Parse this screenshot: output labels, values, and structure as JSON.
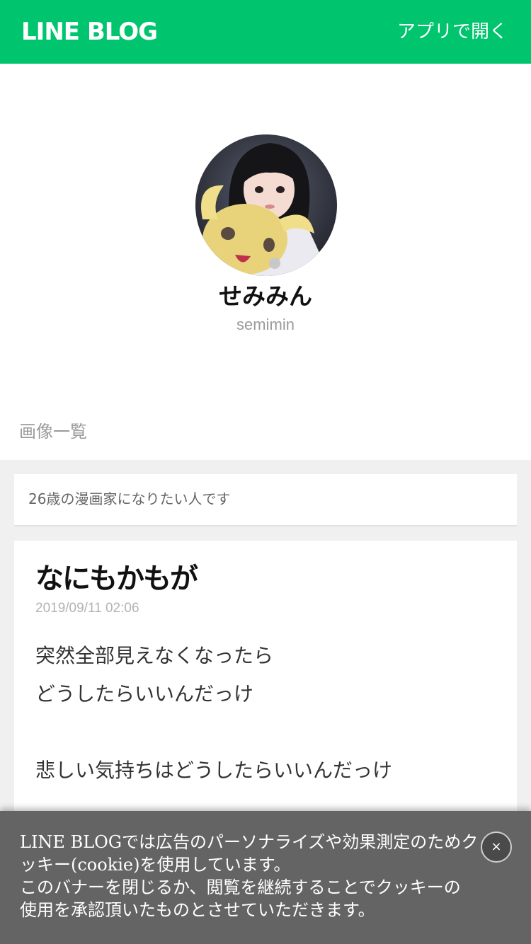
{
  "header": {
    "logo": "LINE BLOG",
    "open_app": "アプリで開く"
  },
  "profile": {
    "name": "せみみん",
    "id": "semimin"
  },
  "image_list_label": "画像一覧",
  "description": "26歳の漫画家になりたい人です",
  "post": {
    "title": "なにもかもが",
    "date": "2019/09/11 02:06",
    "lines": [
      "突然全部見えなくなったら",
      "どうしたらいいんだっけ",
      "",
      "悲しい気持ちはどうしたらいいんだっけ"
    ]
  },
  "cookie_banner": {
    "lines": [
      "LINE BLOGでは広告のパーソナライズや効果測定のためク",
      "ッキー(cookie)を使用しています。",
      "このバナーを閉じるか、閲覧を継続することでクッキーの",
      "使用を承認頂いたものとさせていただきます。"
    ],
    "close_label": "×"
  },
  "colors": {
    "brand": "#00c46e",
    "background": "#f0f0f0"
  }
}
